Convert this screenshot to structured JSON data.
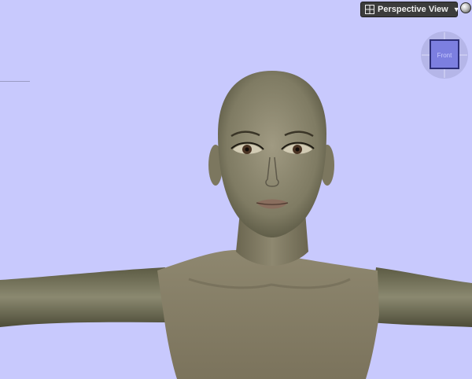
{
  "viewport": {
    "background": "#c8c9fd",
    "view_selector": {
      "label": "Perspective View",
      "icon": "viewport-icon",
      "dropdown_icon": "chevron-down-icon"
    },
    "sphere_button_icon": "sphere-icon",
    "view_cube": {
      "face_label": "Front"
    }
  },
  "figure": {
    "skin_color": "#8c8670",
    "shadow_color": "#54533f"
  }
}
